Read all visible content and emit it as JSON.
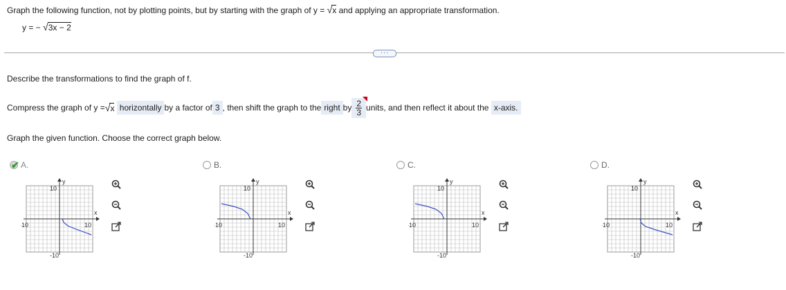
{
  "problem": {
    "instruction_pre": "Graph the following function, not by plotting points, but by starting with the graph of y = ",
    "instruction_sqrt": "x",
    "instruction_post": " and applying an appropriate transformation.",
    "function_pre": "y = −",
    "function_sqrt": "3x − 2"
  },
  "separator_label": "···",
  "describe_prompt": "Describe the transformations to find the graph of f.",
  "sentence": {
    "part1": "Compress the graph of y = ",
    "sqrt": "x",
    "direction1": "horizontally",
    "part2": " by a factor of ",
    "factor": "3",
    "part3": ", then shift the graph to the ",
    "direction2": "right",
    "part4": " by ",
    "shift_num": "2",
    "shift_den": "3",
    "part5": " units, and then reflect it about the ",
    "axis": "x-axis."
  },
  "graph_prompt": "Graph the given function. Choose the correct graph below.",
  "options": [
    {
      "label": "A.",
      "selected": true,
      "curve": "reflected-right"
    },
    {
      "label": "B.",
      "selected": false,
      "curve": "reflected-left"
    },
    {
      "label": "C.",
      "selected": false,
      "curve": "reflected-left-low"
    },
    {
      "label": "D.",
      "selected": false,
      "curve": "reflected-right-long"
    }
  ],
  "axis_labels": {
    "y": "y",
    "x": "x",
    "tick_pos": "10",
    "tick_neg": "-10"
  },
  "icons": [
    "zoom-in-icon",
    "zoom-out-icon",
    "expand-icon",
    "checkmark-icon"
  ],
  "colors": {
    "accent": "#e6ecf5",
    "curve": "#3b4fc4",
    "check": "#2e9b2e",
    "flag": "#d0021b"
  }
}
